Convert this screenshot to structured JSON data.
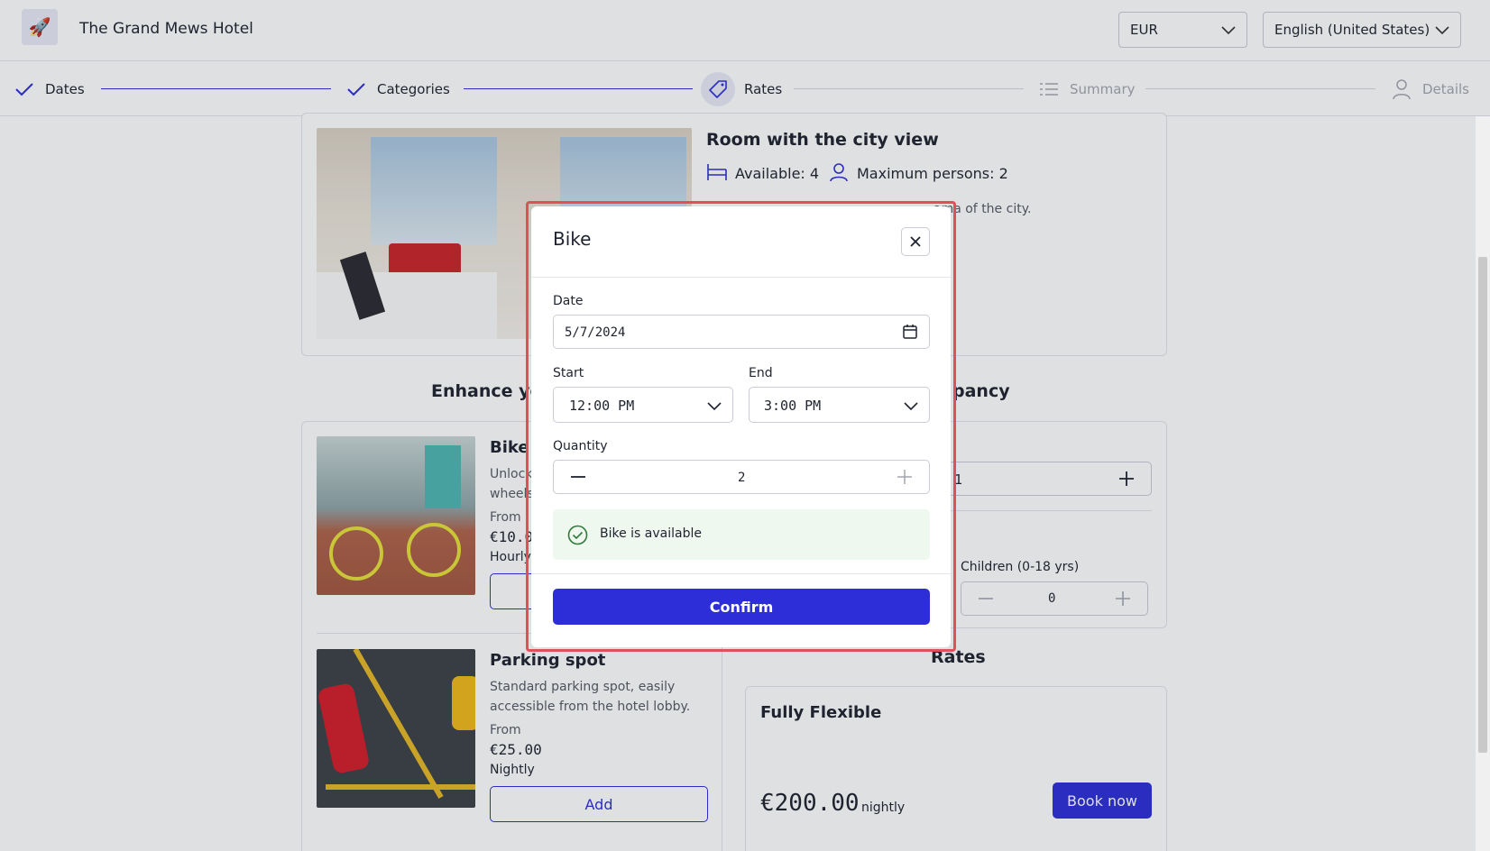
{
  "header": {
    "hotel_name": "The Grand Mews Hotel",
    "logo_icon": "rocket-icon",
    "currency": "EUR",
    "language": "English (United States)"
  },
  "steps": [
    {
      "label": "Dates",
      "state": "done",
      "icon": "check-icon"
    },
    {
      "label": "Categories",
      "state": "done",
      "icon": "check-icon"
    },
    {
      "label": "Rates",
      "state": "active",
      "icon": "tag-icon"
    },
    {
      "label": "Summary",
      "state": "pending",
      "icon": "list-icon"
    },
    {
      "label": "Details",
      "state": "pending",
      "icon": "user-icon"
    }
  ],
  "room": {
    "title": "Room with the city view",
    "available": "Available: 4",
    "max_persons": "Maximum persons: 2",
    "description_visible": "ama of the city."
  },
  "extras": {
    "heading_left": "Enhance yo",
    "heading_right": "pancy",
    "items": [
      {
        "name": "Bike",
        "desc_line1": "Unlock",
        "desc_line2": "wheels",
        "from": "From",
        "price": "€10.0",
        "unit": "Hourly"
      },
      {
        "name": "Parking spot",
        "desc_line1": "Standard parking spot, easily",
        "desc_line2": "accessible from the hotel lobby.",
        "from": "From",
        "price": "€25.00",
        "unit": "Nightly",
        "button": "Add"
      }
    ]
  },
  "occupancy": {
    "children_label": "Children (0-18 yrs)",
    "children_value": "0",
    "partial_value": "1"
  },
  "rates": {
    "heading": "Rates",
    "plan_name": "Fully Flexible",
    "price": "€200.00",
    "unit": "nightly",
    "button": "Book now"
  },
  "modal": {
    "title": "Bike",
    "date_label": "Date",
    "date_value": "5/7/2024",
    "start_label": "Start",
    "start_value": "12:00 PM",
    "end_label": "End",
    "end_value": "3:00 PM",
    "quantity_label": "Quantity",
    "quantity_value": "2",
    "availability": "Bike is available",
    "confirm": "Confirm"
  },
  "colors": {
    "accent": "#2e2ed9",
    "success": "#2f7a3b",
    "success_bg": "#eef8ee",
    "highlight": "#e0505a"
  }
}
